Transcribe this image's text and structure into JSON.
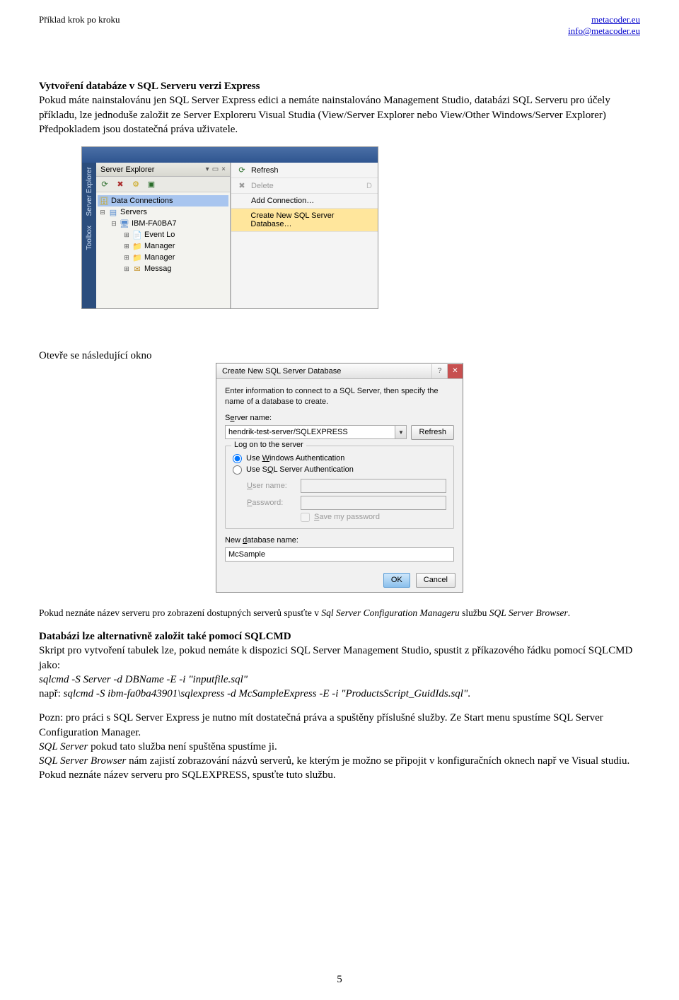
{
  "header": {
    "left": "Příklad krok po kroku",
    "right_line1": "metacoder.eu",
    "right_line2": "info@metacoder.eu"
  },
  "intro": {
    "h1": "Vytvoření databáze v SQL Serveru verzi Express",
    "p1": "Pokud máte nainstalovánu jen SQL Server Express edici a nemáte nainstalováno Management Studio, databázi SQL Serveru pro účely příkladu, lze jednoduše založit ze Server Exploreru Visual Studia (View/Server Explorer nebo View/Other Windows/Server Explorer) Předpokladem jsou dostatečná práva uživatele."
  },
  "shot1": {
    "panel_title": "Server Explorer",
    "side_tab1": "Server Explorer",
    "side_tab2": "Toolbox",
    "title_bar": " ",
    "nodes": {
      "data_conn": "Data Connections",
      "servers": "Servers",
      "ibm": "IBM-FA0BA7",
      "event": "Event Lo",
      "mgr1": "Manager",
      "mgr2": "Manager",
      "msg": "Messag"
    },
    "ctx": {
      "refresh": "Refresh",
      "delete": "Delete",
      "add": "Add Connection…",
      "create": "Create New SQL Server Database…"
    }
  },
  "mid1": "Otevře se následující okno",
  "shot2": {
    "title": "Create New SQL Server Database",
    "help_btn": "?",
    "instr": "Enter information to connect to a SQL Server, then specify the name of a database to create.",
    "server_lbl": "Server name:",
    "server_val": "hendrik-test-server/SQLEXPRESS",
    "refresh_btn": "Refresh",
    "logon_legend": "Log on to the server",
    "r_win": "Use Windows Authentication",
    "r_sql": "Use SQL Server Authentication",
    "user_lbl": "User name:",
    "pass_lbl": "Password:",
    "save_pw": "Save my password",
    "newdb_lbl": "New database name:",
    "newdb_val": "McSample",
    "ok": "OK",
    "cancel": "Cancel"
  },
  "after": {
    "p_note": "Pokud neznáte název serveru pro zobrazení dostupných serverů spusťte v ",
    "p_note_i1": "Sql Server Configuration Manageru",
    "p_note_mid": " službu ",
    "p_note_i2": "SQL Server Browser",
    "p_note_end": ".",
    "h2": "Databázi lze alternativně založit také pomocí SQLCMD",
    "p2": "Skript pro vytvoření tabulek lze, pokud nemáte k dispozici SQL Server Management Studio, spustit z příkazového řádku pomocí SQLCMD jako:",
    "cmd1": "sqlcmd -S Server -d DBName -E -i \"inputfile.sql\"",
    "ex_lbl": "např: ",
    "cmd2": "sqlcmd -S ibm-fa0ba43901\\sqlexpress -d McSampleExpress -E -i \"ProductsScript_GuidIds.sql\"",
    "pozn": "Pozn: pro práci s SQL Server Express je nutno mít dostatečná práva a spuštěny příslušné služby. Ze Start menu spustíme SQL Server Configuration Manager.",
    "sqlserver_lbl": "SQL Server",
    "sqlserver_txt": " pokud tato služba není spuštěna spustíme ji.",
    "browser_lbl": "SQL Server Browser",
    "browser_txt": " nám zajistí zobrazování názvů serverů, ke kterým je možno se připojit v konfiguračních oknech např ve Visual studiu. Pokud neznáte název serveru pro SQLEXPRESS, spusťte tuto službu."
  },
  "page_number": "5"
}
